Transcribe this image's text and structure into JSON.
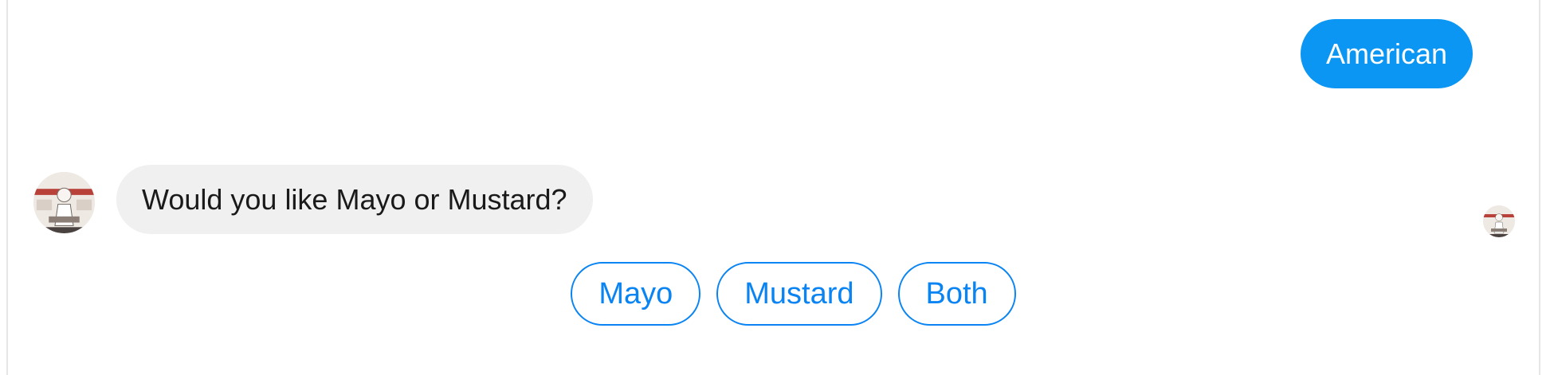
{
  "chat": {
    "user_message": "American",
    "bot_message": "Would you like Mayo or Mustard?",
    "quick_replies": [
      "Mayo",
      "Mustard",
      "Both"
    ]
  },
  "colors": {
    "user_bubble": "#0a96f2",
    "bot_bubble": "#f0f0f0",
    "quick_reply_accent": "#0a84f2"
  },
  "icons": {
    "bot_avatar": "bot-avatar-photo",
    "read_receipt_avatar": "read-receipt-avatar"
  }
}
